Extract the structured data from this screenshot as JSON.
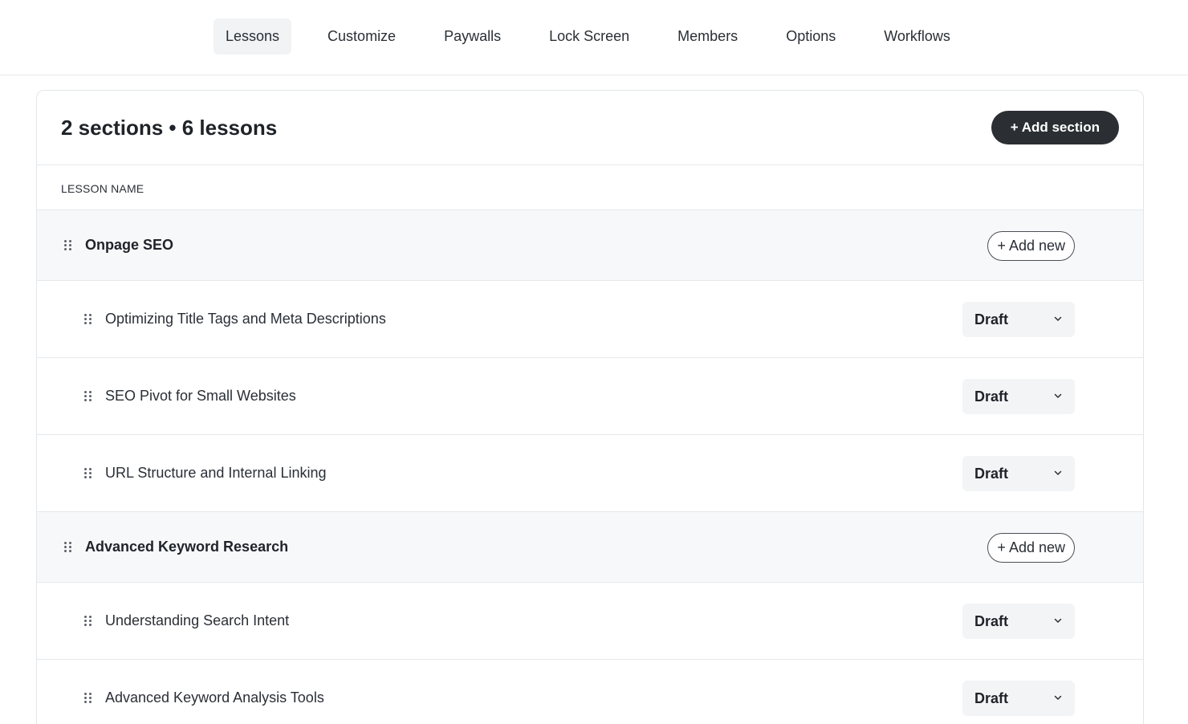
{
  "nav": {
    "tabs": [
      {
        "label": "Lessons",
        "active": true
      },
      {
        "label": "Customize",
        "active": false
      },
      {
        "label": "Paywalls",
        "active": false
      },
      {
        "label": "Lock Screen",
        "active": false
      },
      {
        "label": "Members",
        "active": false
      },
      {
        "label": "Options",
        "active": false
      },
      {
        "label": "Workflows",
        "active": false
      }
    ]
  },
  "header": {
    "summary": "2 sections • 6 lessons",
    "add_section_label": "+ Add section"
  },
  "table": {
    "column_header": "LESSON NAME"
  },
  "sections": [
    {
      "title": "Onpage SEO",
      "add_new_label": "+ Add new",
      "lessons": [
        {
          "title": "Optimizing Title Tags and Meta Descriptions",
          "status": "Draft"
        },
        {
          "title": "SEO Pivot for Small Websites",
          "status": "Draft"
        },
        {
          "title": "URL Structure and Internal Linking",
          "status": "Draft"
        }
      ]
    },
    {
      "title": "Advanced Keyword Research",
      "add_new_label": "+ Add new",
      "lessons": [
        {
          "title": "Understanding Search Intent",
          "status": "Draft"
        },
        {
          "title": "Advanced Keyword Analysis Tools",
          "status": "Draft"
        }
      ]
    }
  ],
  "icons": {
    "drag_handle": "drag-handle-icon",
    "dropdown": "chevron-down-icon"
  },
  "colors": {
    "primary_button": "#2b2f34",
    "section_bg": "#f7f8fa",
    "active_tab_bg": "#f1f3f5"
  }
}
